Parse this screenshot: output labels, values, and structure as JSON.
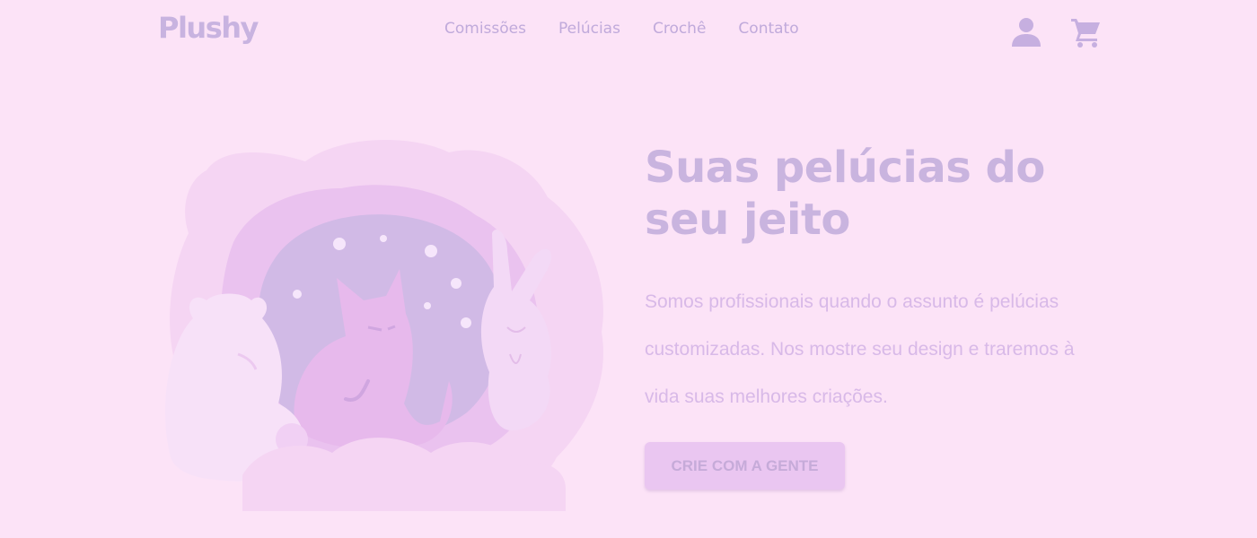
{
  "header": {
    "logo_text": "Plushy",
    "nav": [
      {
        "label": "Comissões"
      },
      {
        "label": "Pelúcias"
      },
      {
        "label": "Crochê"
      },
      {
        "label": "Contato"
      }
    ],
    "icons": {
      "account": "user-icon",
      "cart": "cart-icon"
    }
  },
  "hero": {
    "title": "Suas pelúcias do seu jeito",
    "description": "Somos profissionais quando o assunto é pelúcias customizadas. Nos mostre seu design e traremos à vida suas melhores criações.",
    "cta_label": "CRIE COM A GENTE",
    "illustration": "plush-animals-illustration"
  },
  "colors": {
    "background": "#fce3f7",
    "accent": "#c9b4df",
    "text_muted": "#d8b9e8",
    "button": "#eac6f1"
  }
}
